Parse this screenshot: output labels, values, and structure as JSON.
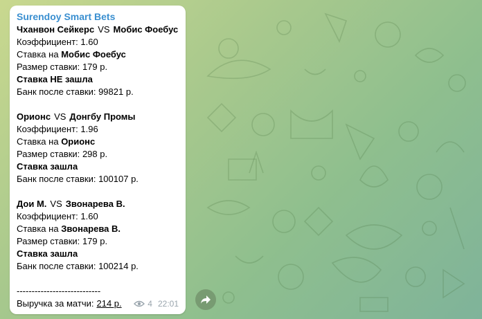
{
  "channel": {
    "name": "Surendoy Smart Bets"
  },
  "bets": [
    {
      "team1": "Чханвон Сейкерс",
      "vs": "VS",
      "team2": "Мобис Фоебус",
      "coef_label": "Коэффициент:",
      "coef": "1.60",
      "bet_on_label": "Ставка на",
      "bet_on": "Мобис Фоебус",
      "size_label": "Размер ставки:",
      "size": "179 р.",
      "result": "Ставка НЕ зашла",
      "bank_label": "Банк после ставки:",
      "bank": "99821 р."
    },
    {
      "team1": "Орионс",
      "vs": "VS",
      "team2": "Донгбу Промы",
      "coef_label": "Коэффициент:",
      "coef": "1.96",
      "bet_on_label": "Ставка на",
      "bet_on": "Орионс",
      "size_label": "Размер ставки:",
      "size": "298 р.",
      "result": "Ставка зашла",
      "bank_label": "Банк после ставки:",
      "bank": "100107 р."
    },
    {
      "team1": "Дои М.",
      "vs": "VS",
      "team2": "Звонарева В.",
      "coef_label": "Коэффициент:",
      "coef": "1.60",
      "bet_on_label": "Ставка на",
      "bet_on": "Звонарева В.",
      "size_label": "Размер ставки:",
      "size": "179 р.",
      "result": "Ставка зашла",
      "bank_label": "Банк после ставки:",
      "bank": "100214 р."
    }
  ],
  "separator": "----------------------------",
  "summary": {
    "label": "Выручка за матчи:",
    "value": "214 р."
  },
  "meta": {
    "views": "4",
    "time": "22:01",
    "icon": "eye-icon"
  },
  "forward": {
    "icon": "forward-arrow-icon"
  },
  "colors": {
    "channel_name": "#3a8fd0",
    "meta": "#9aa5ad"
  }
}
